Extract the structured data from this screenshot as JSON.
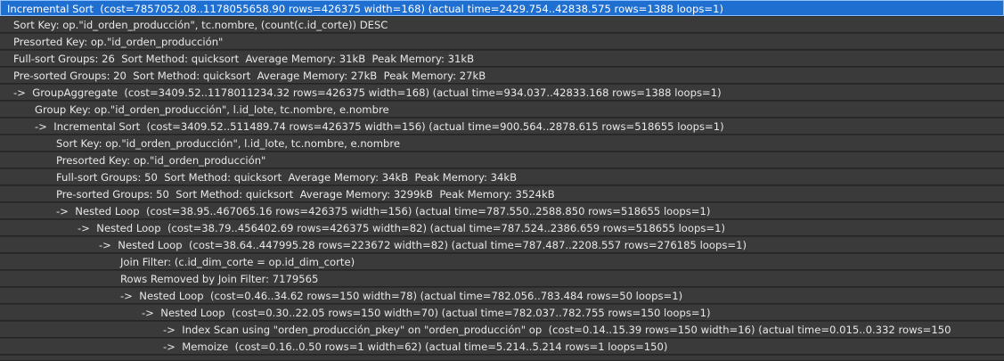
{
  "plan_rows": [
    {
      "level": 0,
      "selected": true,
      "text": "Incremental Sort  (cost=7857052.08..1178055658.90 rows=426375 width=168) (actual time=2429.754..42838.575 rows=1388 loops=1)"
    },
    {
      "level": 1,
      "text": "Sort Key: op.\"id_orden_producción\", tc.nombre, (count(c.id_corte)) DESC"
    },
    {
      "level": 1,
      "text": "Presorted Key: op.\"id_orden_producción\""
    },
    {
      "level": 1,
      "text": "Full-sort Groups: 26  Sort Method: quicksort  Average Memory: 31kB  Peak Memory: 31kB"
    },
    {
      "level": 1,
      "text": "Pre-sorted Groups: 20  Sort Method: quicksort  Average Memory: 27kB  Peak Memory: 27kB"
    },
    {
      "level": 1,
      "text": "->  GroupAggregate  (cost=3409.52..1178011234.32 rows=426375 width=168) (actual time=934.037..42833.168 rows=1388 loops=1)"
    },
    {
      "level": 2,
      "text": "Group Key: op.\"id_orden_producción\", l.id_lote, tc.nombre, e.nombre"
    },
    {
      "level": 2,
      "text": "->  Incremental Sort  (cost=3409.52..511489.74 rows=426375 width=156) (actual time=900.564..2878.615 rows=518655 loops=1)"
    },
    {
      "level": 3,
      "text": "Sort Key: op.\"id_orden_producción\", l.id_lote, tc.nombre, e.nombre"
    },
    {
      "level": 3,
      "text": "Presorted Key: op.\"id_orden_producción\""
    },
    {
      "level": 3,
      "text": "Full-sort Groups: 50  Sort Method: quicksort  Average Memory: 34kB  Peak Memory: 34kB"
    },
    {
      "level": 3,
      "text": "Pre-sorted Groups: 50  Sort Method: quicksort  Average Memory: 3299kB  Peak Memory: 3524kB"
    },
    {
      "level": 3,
      "text": "->  Nested Loop  (cost=38.95..467065.16 rows=426375 width=156) (actual time=787.550..2588.850 rows=518655 loops=1)"
    },
    {
      "level": 4,
      "text": "->  Nested Loop  (cost=38.79..456402.69 rows=426375 width=82) (actual time=787.524..2386.659 rows=518655 loops=1)"
    },
    {
      "level": 5,
      "text": "->  Nested Loop  (cost=38.64..447995.28 rows=223672 width=82) (actual time=787.487..2208.557 rows=276185 loops=1)"
    },
    {
      "level": 6,
      "text": "Join Filter: (c.id_dim_corte = op.id_dim_corte)"
    },
    {
      "level": 6,
      "text": "Rows Removed by Join Filter: 7179565"
    },
    {
      "level": 6,
      "text": "->  Nested Loop  (cost=0.46..34.62 rows=150 width=78) (actual time=782.056..783.484 rows=50 loops=1)"
    },
    {
      "level": 7,
      "text": "->  Nested Loop  (cost=0.30..22.05 rows=150 width=70) (actual time=782.037..782.755 rows=150 loops=1)"
    },
    {
      "level": 8,
      "text": "->  Index Scan using \"orden_producción_pkey\" on \"orden_producción\" op  (cost=0.14..15.39 rows=150 width=16) (actual time=0.015..0.332 rows=150"
    },
    {
      "level": 8,
      "text": "->  Memoize  (cost=0.16..0.50 rows=1 width=62) (actual time=5.214..5.214 rows=1 loops=150)"
    }
  ]
}
